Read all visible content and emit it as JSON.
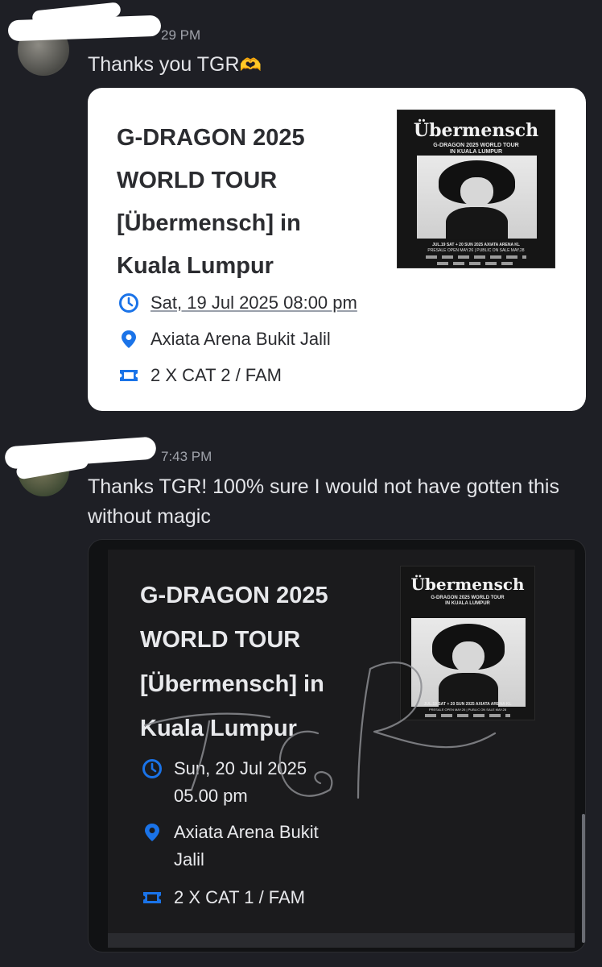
{
  "colors": {
    "background": "#1e1f25",
    "icon_blue": "#1a73e8",
    "card_light": "#ffffff",
    "card_dark": "#111214"
  },
  "messages": [
    {
      "time": "7:39 PM",
      "time_visible": "29 PM",
      "text": "Thanks you TGR",
      "emoji": "🫶",
      "event": {
        "title": "G-DRAGON 2025 WORLD TOUR [Übermensch] in Kuala Lumpur",
        "datetime": "Sat, 19 Jul 2025 08:00 pm",
        "venue": "Axiata Arena Bukit Jalil",
        "tickets": "2 X CAT 2 / FAM",
        "icons": [
          "clock-icon",
          "location-pin-icon",
          "ticket-icon"
        ]
      }
    },
    {
      "time": "7:43 PM",
      "text": "Thanks TGR! 100% sure I would not have gotten this without magic",
      "event": {
        "title": "G-DRAGON 2025 WORLD TOUR [Übermensch] in Kuala Lumpur",
        "datetime_line1": "Sun, 20 Jul 2025",
        "datetime_line2": "05.00 pm",
        "venue_line1": "Axiata Arena Bukit",
        "venue_line2": "Jalil",
        "tickets": "2 X CAT 1 / FAM",
        "icons": [
          "clock-icon",
          "location-pin-icon",
          "ticket-icon"
        ]
      }
    }
  ],
  "poster": {
    "title": "Übermensch",
    "subtitle": "G-DRAGON 2025 WORLD TOUR",
    "subtitle2": "IN KUALA LUMPUR",
    "dates": "JUL.19 SAT + 20 SUN 2025 AXIATA ARENA KL",
    "presale": "PRESALE OPEN MAY.26 | PUBLIC ON SALE MAY.28"
  },
  "watermark": "TGR"
}
